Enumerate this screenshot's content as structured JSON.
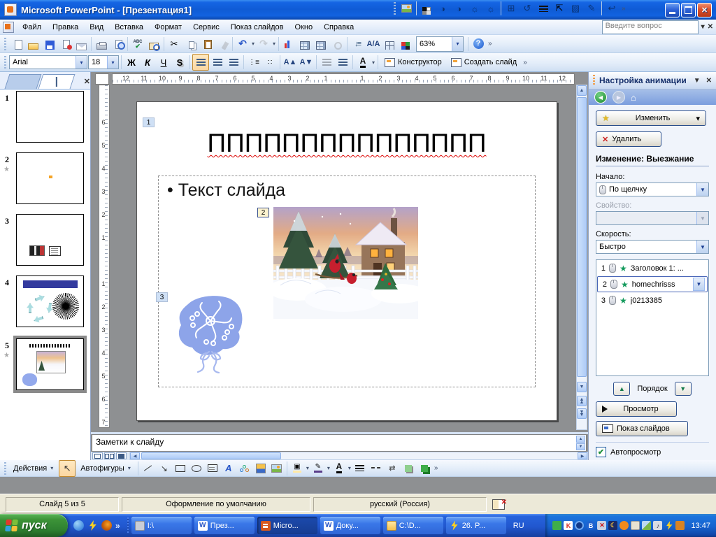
{
  "icons": {
    "close": "✕",
    "dropdown": "▾",
    "chevron_dn": "»",
    "cut": "✂",
    "undo": "↶",
    "redo": "↷",
    "help": "?",
    "up": "▲",
    "down": "▼",
    "left": "◀",
    "right": "▶",
    "star": "★",
    "check": "✔",
    "home": "⌂",
    "bullet": "•",
    "expand": "↓≡",
    "format_aa": "A/A",
    "num_list": "⋮≡",
    "bul_list": "∷",
    "font_up": "A▲",
    "font_dn": "A▼",
    "line": "╲",
    "arrow_se": "↘",
    "qmark": "?"
  },
  "titlebar": {
    "title": "Microsoft PowerPoint - [Презентация1]"
  },
  "menubar": {
    "items": [
      "Файл",
      "Правка",
      "Вид",
      "Вставка",
      "Формат",
      "Сервис",
      "Показ слайдов",
      "Окно",
      "Справка"
    ],
    "question_box": "Введите вопрос"
  },
  "standard_toolbar": {
    "zoom": "63%"
  },
  "formatting_toolbar": {
    "font_name": "Arial",
    "font_size": "18",
    "bold": "Ж",
    "italic": "К",
    "underline": "Ч",
    "shadow": "S",
    "font_color_letter": "А",
    "design": "Конструктор",
    "new_slide": "Создать слайд"
  },
  "slides_panel": {
    "numbers": [
      "1",
      "2",
      "3",
      "4",
      "5"
    ],
    "selected": "5"
  },
  "slide": {
    "anim_badges": [
      "1",
      "2",
      "3"
    ],
    "title": "ППППППППППППППП",
    "bullet": "Текст слайда"
  },
  "rulers": {
    "horizontal": [
      "12",
      "11",
      "10",
      "9",
      "8",
      "7",
      "6",
      "5",
      "4",
      "3",
      "2",
      "1",
      "",
      "1",
      "2",
      "3",
      "4",
      "5",
      "6",
      "7",
      "8",
      "9",
      "10",
      "11",
      "12"
    ],
    "vertical": [
      "6",
      "5",
      "4",
      "3",
      "2",
      "1",
      "",
      "1",
      "2",
      "3",
      "4",
      "5",
      "6",
      "7"
    ]
  },
  "notes": {
    "placeholder": "Заметки к слайду"
  },
  "task_pane": {
    "title": "Настройка анимации",
    "change": "Изменить",
    "remove": "Удалить",
    "section_header": "Изменение: Выезжание",
    "start_label": "Начало:",
    "start_value": "По щелчку",
    "property_label": "Свойство:",
    "property_value": "",
    "speed_label": "Скорость:",
    "speed_value": "Быстро",
    "animations": [
      {
        "num": "1",
        "label": "Заголовок 1: ...",
        "selected": false
      },
      {
        "num": "2",
        "label": "homechrisss",
        "selected": true
      },
      {
        "num": "3",
        "label": "j0213385",
        "selected": false
      }
    ],
    "order": "Порядок",
    "play": "Просмотр",
    "slide_show": "Показ слайдов",
    "auto_preview": "Автопросмотр"
  },
  "drawing_toolbar": {
    "actions": "Действия",
    "autoshapes": "Автофигуры"
  },
  "status_bar": {
    "slide": "Слайд 5 из 5",
    "design": "Оформление по умолчанию",
    "language": "русский (Россия)"
  },
  "taskbar": {
    "start": "пуск",
    "windows": [
      {
        "label": "I:\\",
        "icon": "drive",
        "active": false
      },
      {
        "label": "През...",
        "icon": "word",
        "active": false
      },
      {
        "label": "Micro...",
        "icon": "powerpoint",
        "active": true
      },
      {
        "label": "Доку...",
        "icon": "word",
        "active": false
      },
      {
        "label": "C:\\D...",
        "icon": "folder",
        "active": false
      },
      {
        "label": "26. P...",
        "icon": "flash",
        "active": false
      }
    ],
    "language": "RU",
    "tray_icons": [
      "recycle",
      "kaspersky",
      "media",
      "bluetooth",
      "network",
      "moon",
      "agent",
      "shield",
      "image",
      "speaker",
      "flash2",
      "book"
    ],
    "clock": "13:47"
  }
}
